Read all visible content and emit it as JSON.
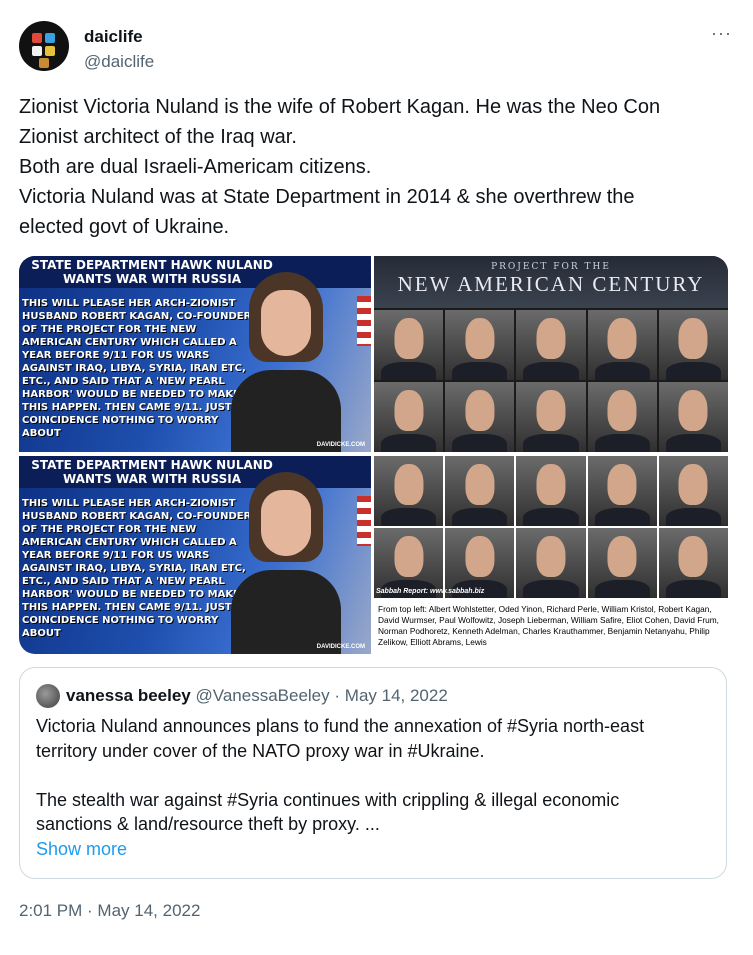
{
  "author": {
    "display_name": "daiclife",
    "handle": "@daiclife",
    "more_label": "···"
  },
  "tweet": {
    "lines": [
      "Zionist Victoria Nuland is the wife of Robert Kagan. He was the Neo Con",
      "Zionist architect of the Iraq war.",
      "Both are dual Israeli-Americam citizens.",
      "Victoria Nuland was at State Department in 2014 & she overthrew the",
      "elected govt of Ukraine."
    ]
  },
  "media": {
    "nuland_headline": "State Department Hawk Nuland Wants War with Russia",
    "nuland_body": "THIS WILL PLEASE HER ARCH-ZIONIST HUSBAND ROBERT KAGAN, CO-FOUNDER OF THE PROJECT FOR THE NEW AMERICAN CENTURY WHICH CALLED A YEAR BEFORE 9/11 FOR US WARS AGAINST IRAQ, LIBYA, SYRIA, IRAN ETC, ETC., AND SAID THAT A 'NEW PEARL HARBOR' WOULD BE NEEDED TO MAKE THIS HAPPEN. THEN CAME 9/11. JUST A COINCIDENCE NOTHING TO WORRY ABOUT",
    "nuland_credit": "DAVIDICKE.COM",
    "pnac_subtitle": "PROJECT FOR THE",
    "pnac_title": "NEW AMERICAN CENTURY",
    "sabbah_credit": "Sabbah Report: www.sabbah.biz",
    "caption": "From top left: Albert Wohlstetter, Oded Yinon, Richard Perle, William Kristol, Robert Kagan, David Wurmser, Paul Wolfowitz, Joseph Lieberman, William Safire, Eliot Cohen, David Frum, Norman Podhoretz, Kenneth Adelman, Charles Krauthammer, Benjamin Netanyahu, Philip Zelikow, Elliott Abrams, Lewis"
  },
  "quote": {
    "name": "vanessa beeley",
    "handle": "@VanessaBeeley",
    "separator": "·",
    "date": "May 14, 2022",
    "lines": [
      "Victoria Nuland announces plans to fund the annexation of #Syria north-east",
      "territory under cover of the NATO proxy war in #Ukraine.",
      "",
      "The stealth war against #Syria continues with crippling & illegal  economic",
      "sanctions & land/resource theft by proxy. ..."
    ],
    "show_more": "Show more"
  },
  "footer": {
    "timestamp": "2:01 PM · May 14, 2022"
  },
  "colors": {
    "link": "#1d9bf0",
    "secondary_text": "#536471",
    "border": "#cfd9de"
  }
}
